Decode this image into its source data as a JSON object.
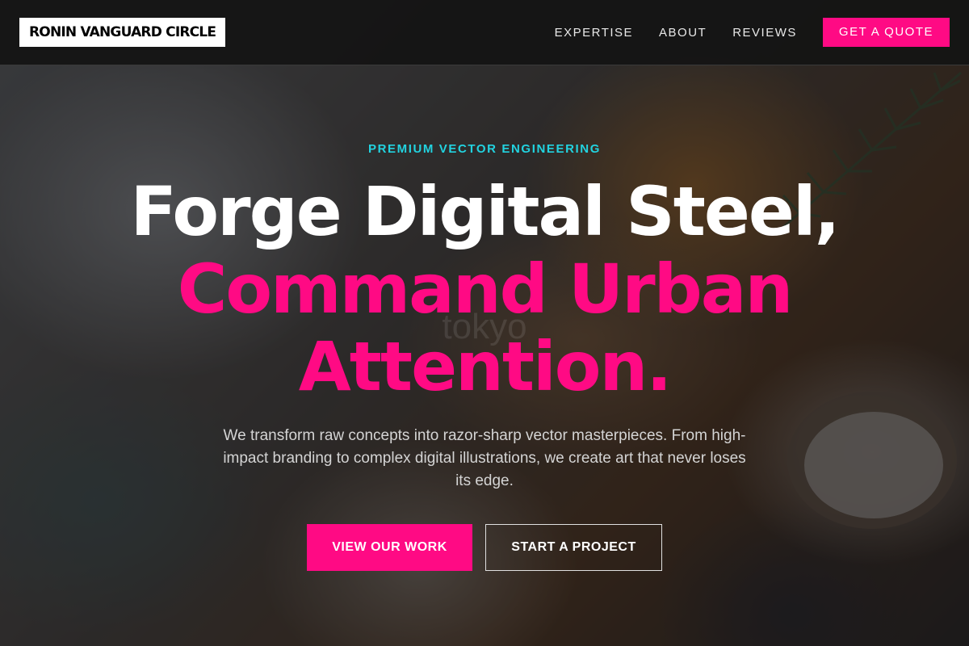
{
  "brand": {
    "logo_text": "RONIN VANGUARD CIRCLE",
    "accent_color": "#ff0a84",
    "eyebrow_color": "#22d3e0"
  },
  "nav": {
    "items": [
      {
        "label": "EXPERTISE"
      },
      {
        "label": "ABOUT"
      },
      {
        "label": "REVIEWS"
      }
    ],
    "cta_label": "GET A QUOTE"
  },
  "hero": {
    "eyebrow": "PREMIUM VECTOR ENGINEERING",
    "headline_line1": "Forge Digital Steel,",
    "headline_line2": "Command Urban",
    "headline_line3": "Attention.",
    "subtext": "We transform raw concepts into razor-sharp vector masterpieces. From high-impact branding to complex digital illustrations, we create art that never loses its edge.",
    "primary_button": "VIEW OUR WORK",
    "secondary_button": "START A PROJECT",
    "background_watermark": "tokyo"
  }
}
